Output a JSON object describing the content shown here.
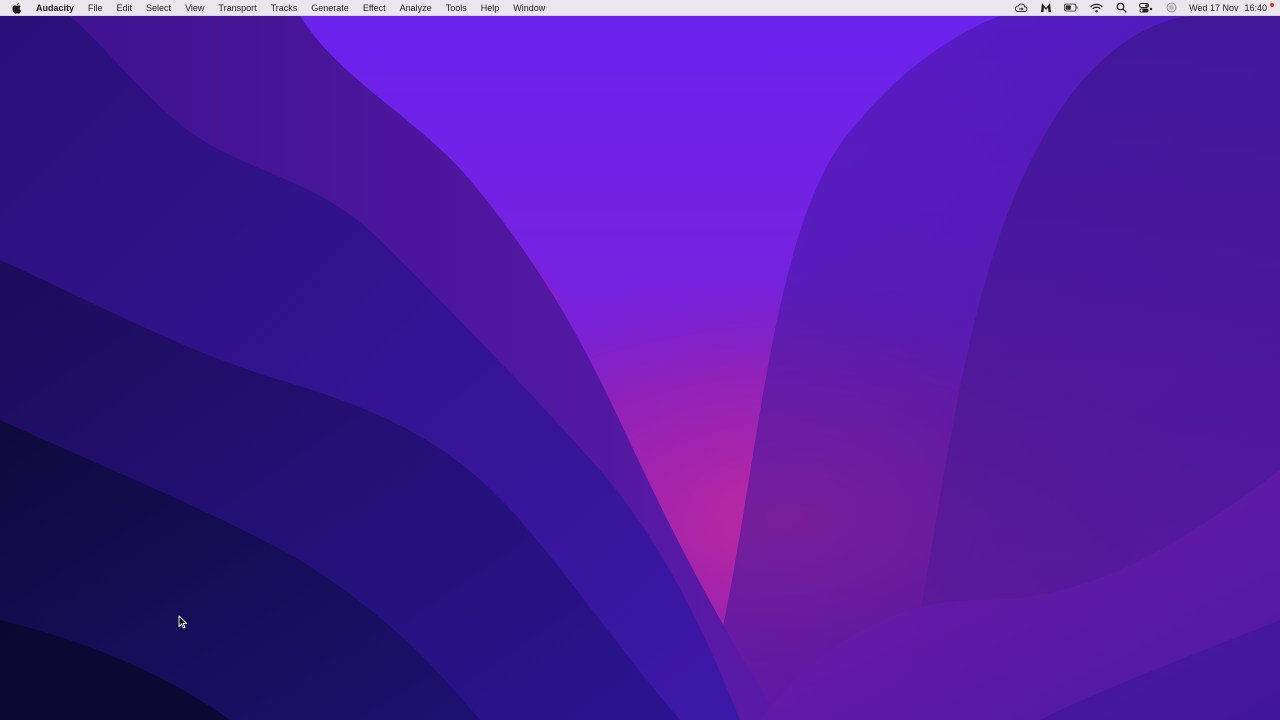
{
  "menubar": {
    "apple_icon": "apple-logo-icon",
    "app_name": "Audacity",
    "menus": [
      "File",
      "Edit",
      "Select",
      "View",
      "Transport",
      "Tracks",
      "Generate",
      "Effect",
      "Analyze",
      "Tools",
      "Help",
      "Window"
    ],
    "status_icons": [
      "cloud-sync-icon",
      "malwarebytes-icon",
      "battery-icon",
      "wifi-icon",
      "spotlight-search-icon",
      "control-center-icon",
      "siri-icon"
    ],
    "clock": {
      "date": "Wed 17 Nov",
      "time": "16:40"
    },
    "recording_indicator_color": "#e0391f"
  },
  "desktop": {
    "wallpaper": "macOS Monterey purple wallpaper",
    "colors": {
      "sky": "#6a22ea",
      "glow": "#b0269e",
      "deep": "#0c0a3a"
    }
  },
  "cursor": "mouse-pointer-icon"
}
